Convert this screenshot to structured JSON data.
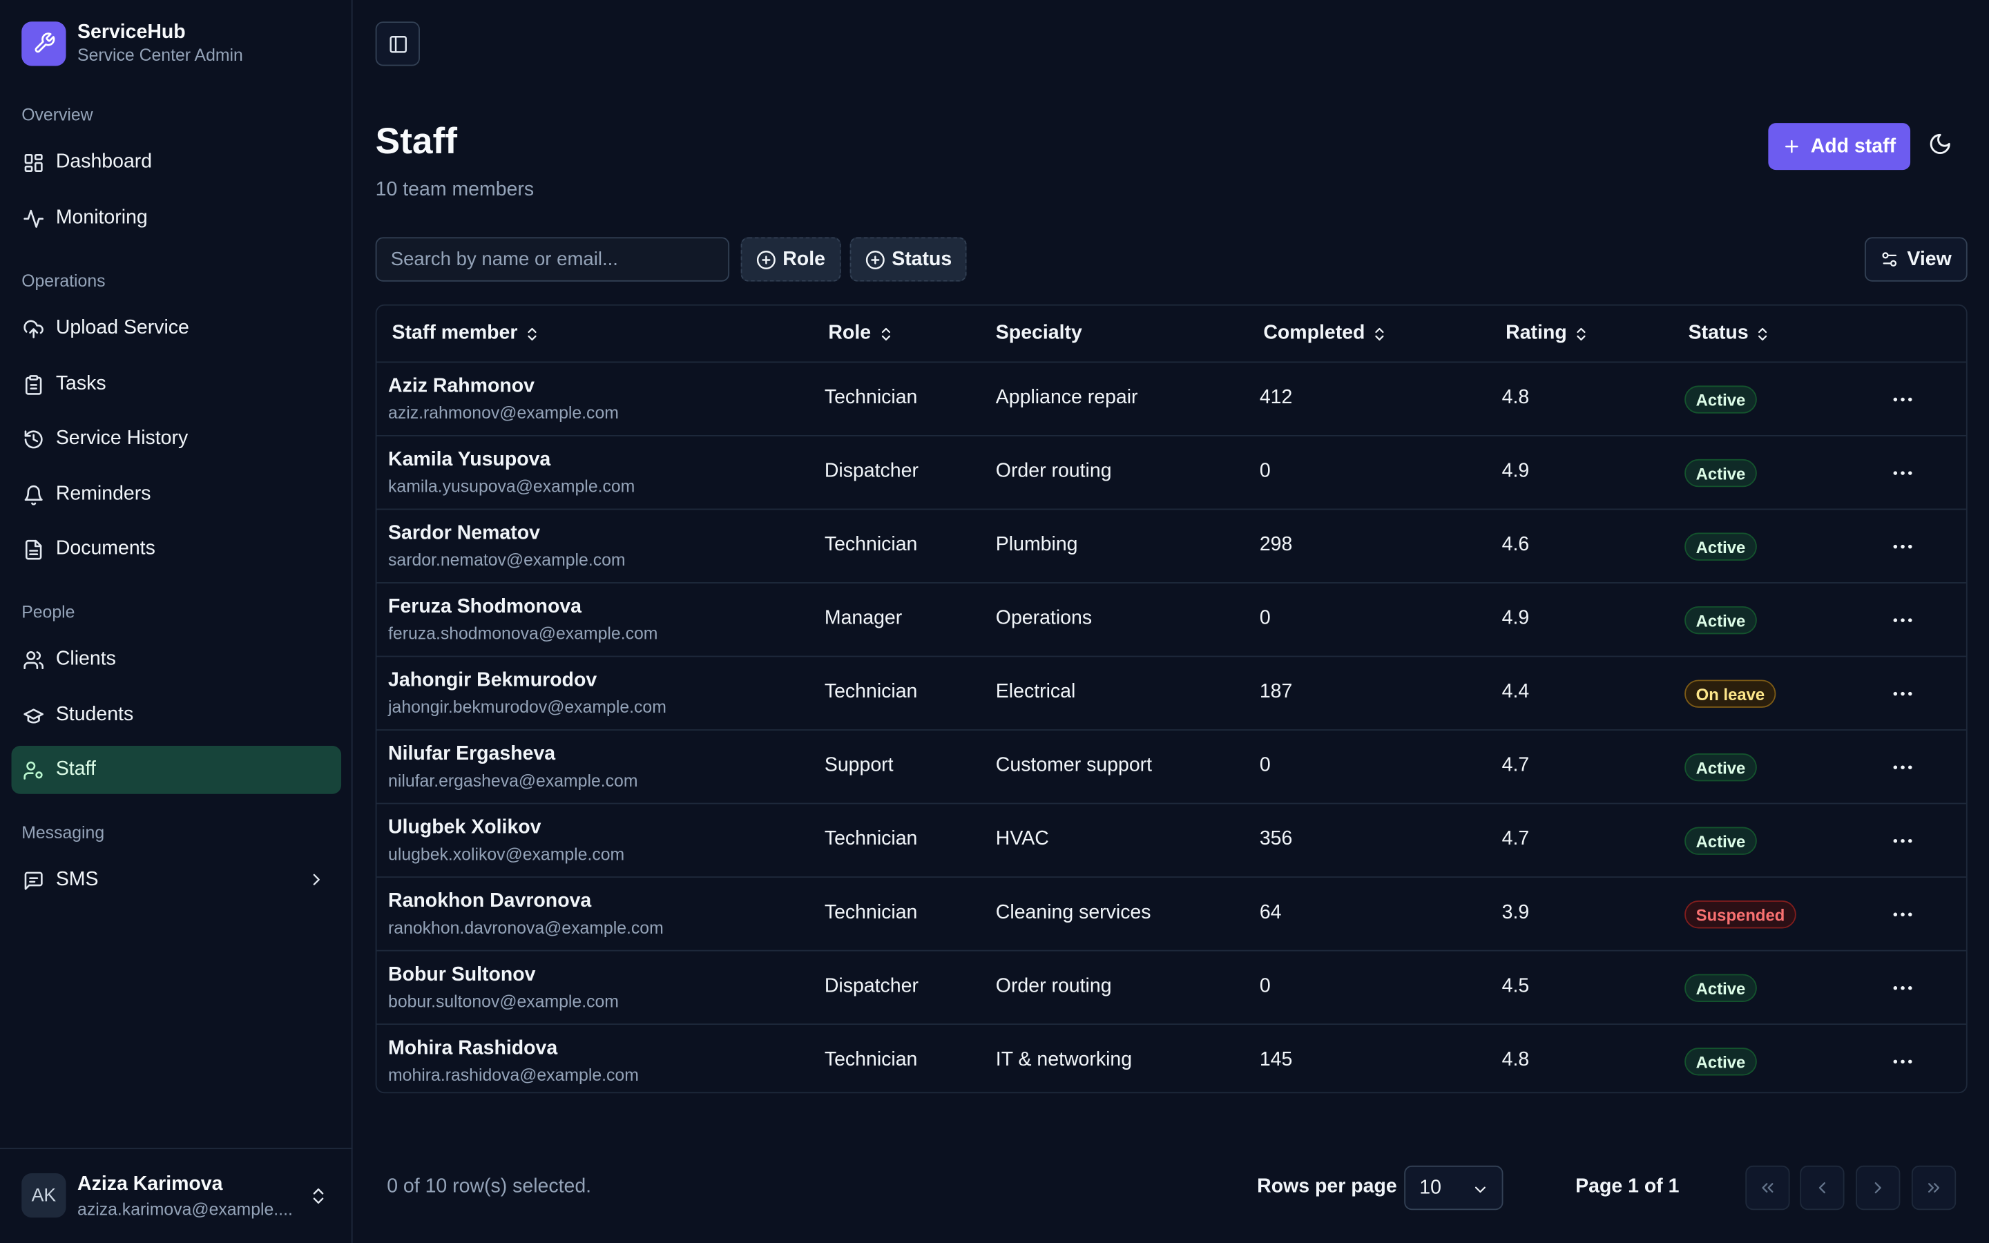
{
  "brand": {
    "name": "ServiceHub",
    "subtitle": "Service Center Admin"
  },
  "sidebar": {
    "sections": {
      "overview": "Overview",
      "operations": "Operations",
      "people": "People",
      "messaging": "Messaging"
    },
    "items": {
      "dashboard": "Dashboard",
      "monitoring": "Monitoring",
      "upload_service": "Upload Service",
      "tasks": "Tasks",
      "service_history": "Service History",
      "reminders": "Reminders",
      "documents": "Documents",
      "clients": "Clients",
      "students": "Students",
      "staff": "Staff",
      "sms": "SMS"
    },
    "active_item": "Staff"
  },
  "user": {
    "initials": "AK",
    "name": "Aziza Karimova",
    "email": "aziza.karimova@example...."
  },
  "page": {
    "title": "Staff",
    "subtitle": "10 team members",
    "add_label": "Add staff"
  },
  "toolbar": {
    "search_placeholder": "Search by name or email...",
    "role_filter": "Role",
    "status_filter": "Status",
    "view_label": "View"
  },
  "table": {
    "columns": {
      "staff": "Staff member",
      "role": "Role",
      "specialty": "Specialty",
      "completed": "Completed",
      "rating": "Rating",
      "status": "Status"
    },
    "rows": [
      {
        "name": "Aziz Rahmonov",
        "email": "aziz.rahmonov@example.com",
        "role": "Technician",
        "specialty": "Appliance repair",
        "completed": "412",
        "rating": "4.8",
        "status": "Active"
      },
      {
        "name": "Kamila Yusupova",
        "email": "kamila.yusupova@example.com",
        "role": "Dispatcher",
        "specialty": "Order routing",
        "completed": "0",
        "rating": "4.9",
        "status": "Active"
      },
      {
        "name": "Sardor Nematov",
        "email": "sardor.nematov@example.com",
        "role": "Technician",
        "specialty": "Plumbing",
        "completed": "298",
        "rating": "4.6",
        "status": "Active"
      },
      {
        "name": "Feruza Shodmonova",
        "email": "feruza.shodmonova@example.com",
        "role": "Manager",
        "specialty": "Operations",
        "completed": "0",
        "rating": "4.9",
        "status": "Active"
      },
      {
        "name": "Jahongir Bekmurodov",
        "email": "jahongir.bekmurodov@example.com",
        "role": "Technician",
        "specialty": "Electrical",
        "completed": "187",
        "rating": "4.4",
        "status": "On leave"
      },
      {
        "name": "Nilufar Ergasheva",
        "email": "nilufar.ergasheva@example.com",
        "role": "Support",
        "specialty": "Customer support",
        "completed": "0",
        "rating": "4.7",
        "status": "Active"
      },
      {
        "name": "Ulugbek Xolikov",
        "email": "ulugbek.xolikov@example.com",
        "role": "Technician",
        "specialty": "HVAC",
        "completed": "356",
        "rating": "4.7",
        "status": "Active"
      },
      {
        "name": "Ranokhon Davronova",
        "email": "ranokhon.davronova@example.com",
        "role": "Technician",
        "specialty": "Cleaning services",
        "completed": "64",
        "rating": "3.9",
        "status": "Suspended"
      },
      {
        "name": "Bobur Sultonov",
        "email": "bobur.sultonov@example.com",
        "role": "Dispatcher",
        "specialty": "Order routing",
        "completed": "0",
        "rating": "4.5",
        "status": "Active"
      },
      {
        "name": "Mohira Rashidova",
        "email": "mohira.rashidova@example.com",
        "role": "Technician",
        "specialty": "IT & networking",
        "completed": "145",
        "rating": "4.8",
        "status": "Active"
      }
    ]
  },
  "footer": {
    "selection": "0 of 10 row(s) selected.",
    "rows_per_page_label": "Rows per page",
    "rows_per_page_value": "10",
    "page_info": "Page 1 of 1"
  },
  "colors": {
    "accent": "#6d5cf0",
    "active_nav": "#17443a",
    "background": "#0b1120"
  }
}
